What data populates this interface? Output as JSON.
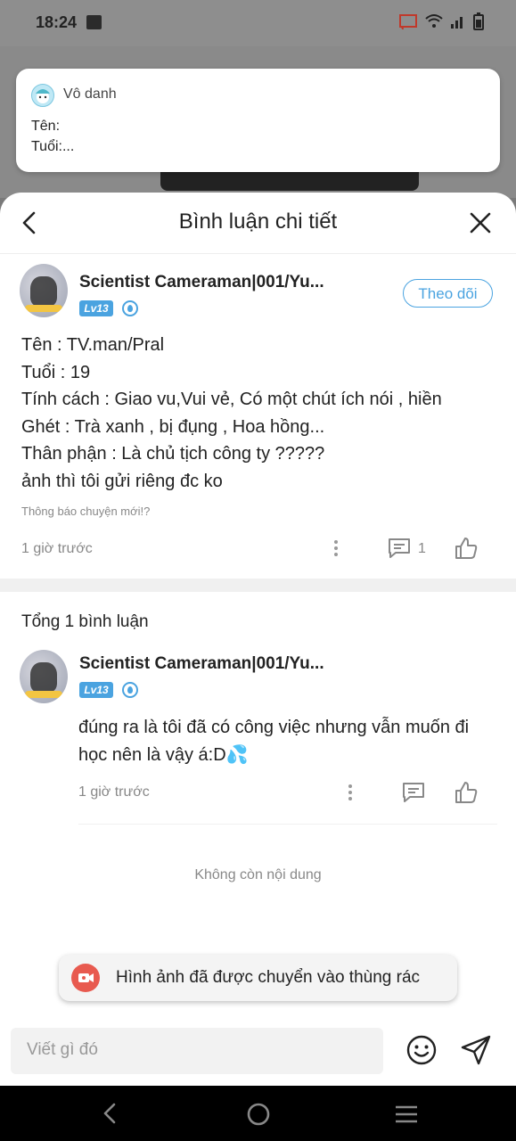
{
  "status_bar": {
    "time": "18:24"
  },
  "notification": {
    "sender": "Vô danh",
    "line1": "Tên:",
    "line2": "Tuổi:..."
  },
  "sheet": {
    "title": "Bình luận chi tiết"
  },
  "post": {
    "username": "Scientist Cameraman|001/Yu...",
    "level": "Lv13",
    "follow_label": "Theo dõi",
    "lines": [
      "Tên : TV.man/Pral",
      "Tuổi : 19",
      "Tính cách : Giao vu,Vui vẻ, Có một chút ích nói , hiền",
      "Ghét : Trà xanh , bị đụng , Hoa hồng...",
      "Thân phận : Là chủ tịch công ty ?????",
      "ảnh thì tôi gửi riêng đc ko"
    ],
    "hint": "Thông báo chuyện mới!?",
    "time": "1 giờ trước",
    "comment_count": "1"
  },
  "comments": {
    "total_label": "Tổng 1 bình luận",
    "items": [
      {
        "username": "Scientist Cameraman|001/Yu...",
        "level": "Lv13",
        "text": "đúng ra là tôi đã có công việc nhưng vẫn muốn đi học nên là vậy á:D💦",
        "time": "1 giờ trước"
      }
    ],
    "no_more": "Không còn nội dung"
  },
  "toast": {
    "text": "Hình ảnh đã được chuyển vào thùng rác"
  },
  "composer": {
    "placeholder": "Viết gì đó"
  },
  "colors": {
    "accent": "#4aa3e0",
    "toast_icon": "#e85a4f"
  }
}
